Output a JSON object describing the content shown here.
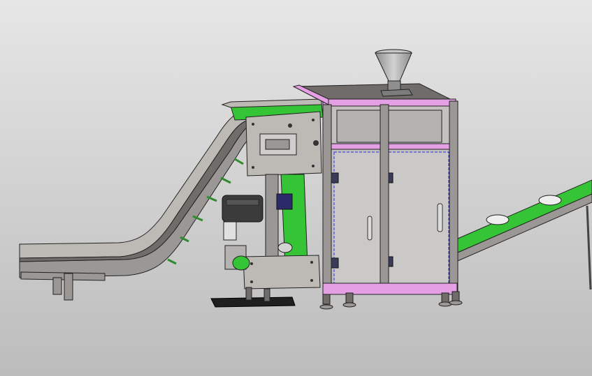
{
  "scene": {
    "subject": "vertical-packaging-machine-assembly",
    "colors": {
      "background_top": "#e6e6e6",
      "background_bottom": "#bcbcbc",
      "metal": "#9a9794",
      "metal_light": "#bdbab6",
      "metal_dark": "#6f6c69",
      "panel": "#c3c1bf",
      "belt_green": "#35c435",
      "frame_pink": "#e59fe5",
      "edge_blue": "#2a2ae0",
      "outline": "#222222",
      "hopper": "#a9a9a9"
    }
  }
}
